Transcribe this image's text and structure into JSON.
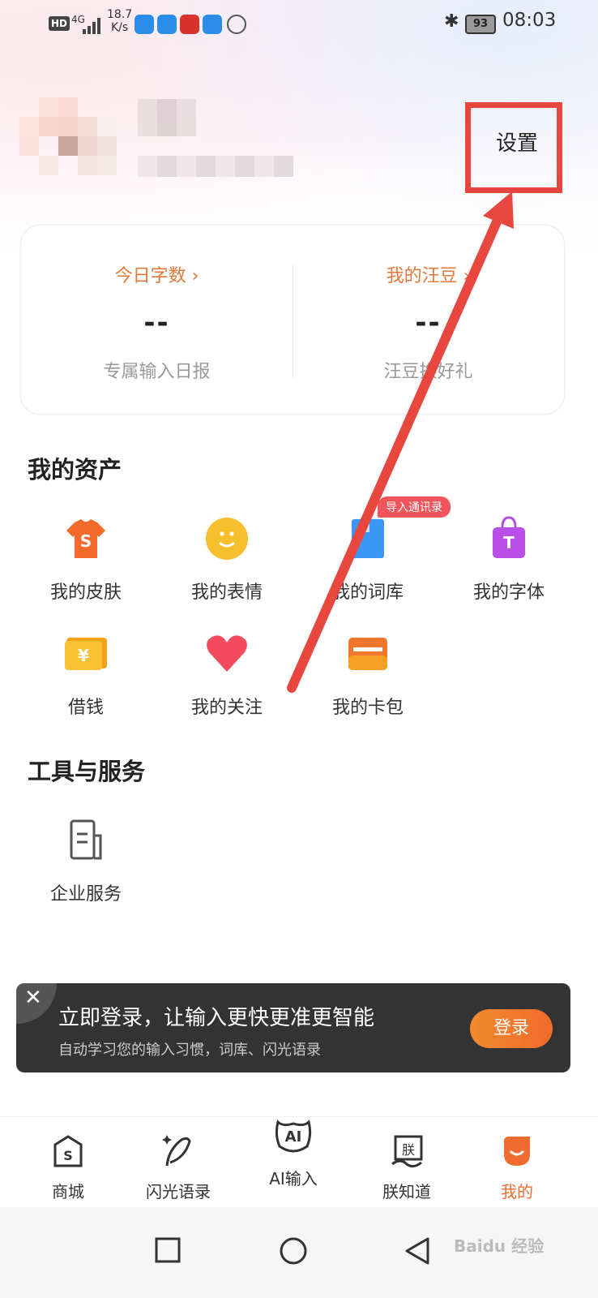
{
  "status_bar": {
    "hd": "HD",
    "network": "4G",
    "speed_value": "18.7",
    "speed_unit": "K/s",
    "battery": "93",
    "time": "08:03"
  },
  "header": {
    "settings_label": "设置"
  },
  "stats": {
    "left": {
      "title": "今日字数",
      "value": "--",
      "desc": "专属输入日报"
    },
    "right": {
      "title": "我的汪豆",
      "value": "--",
      "desc": "汪豆换好礼"
    }
  },
  "assets": {
    "title": "我的资产",
    "badge": "导入通讯录",
    "items": [
      {
        "label": "我的皮肤"
      },
      {
        "label": "我的表情"
      },
      {
        "label": "我的词库"
      },
      {
        "label": "我的字体"
      },
      {
        "label": "借钱"
      },
      {
        "label": "我的关注"
      },
      {
        "label": "我的卡包"
      }
    ]
  },
  "tools": {
    "title": "工具与服务",
    "items": [
      {
        "label": "企业服务"
      }
    ]
  },
  "banner": {
    "headline": "立即登录，让输入更快更准更智能",
    "sub": "自动学习您的输入习惯，词库、闪光语录",
    "login_label": "登录"
  },
  "bottom_nav": {
    "items": [
      {
        "label": "商城"
      },
      {
        "label": "闪光语录"
      },
      {
        "label": "AI输入"
      },
      {
        "label": "朕知道"
      },
      {
        "label": "我的"
      }
    ],
    "ai_icon_text": "AI",
    "zhen_icon_text": "朕"
  },
  "watermark": "Baidu 经验",
  "colors": {
    "accent": "#ef6b2e",
    "highlight_red": "#e8473f",
    "banner_bg": "#333333"
  }
}
